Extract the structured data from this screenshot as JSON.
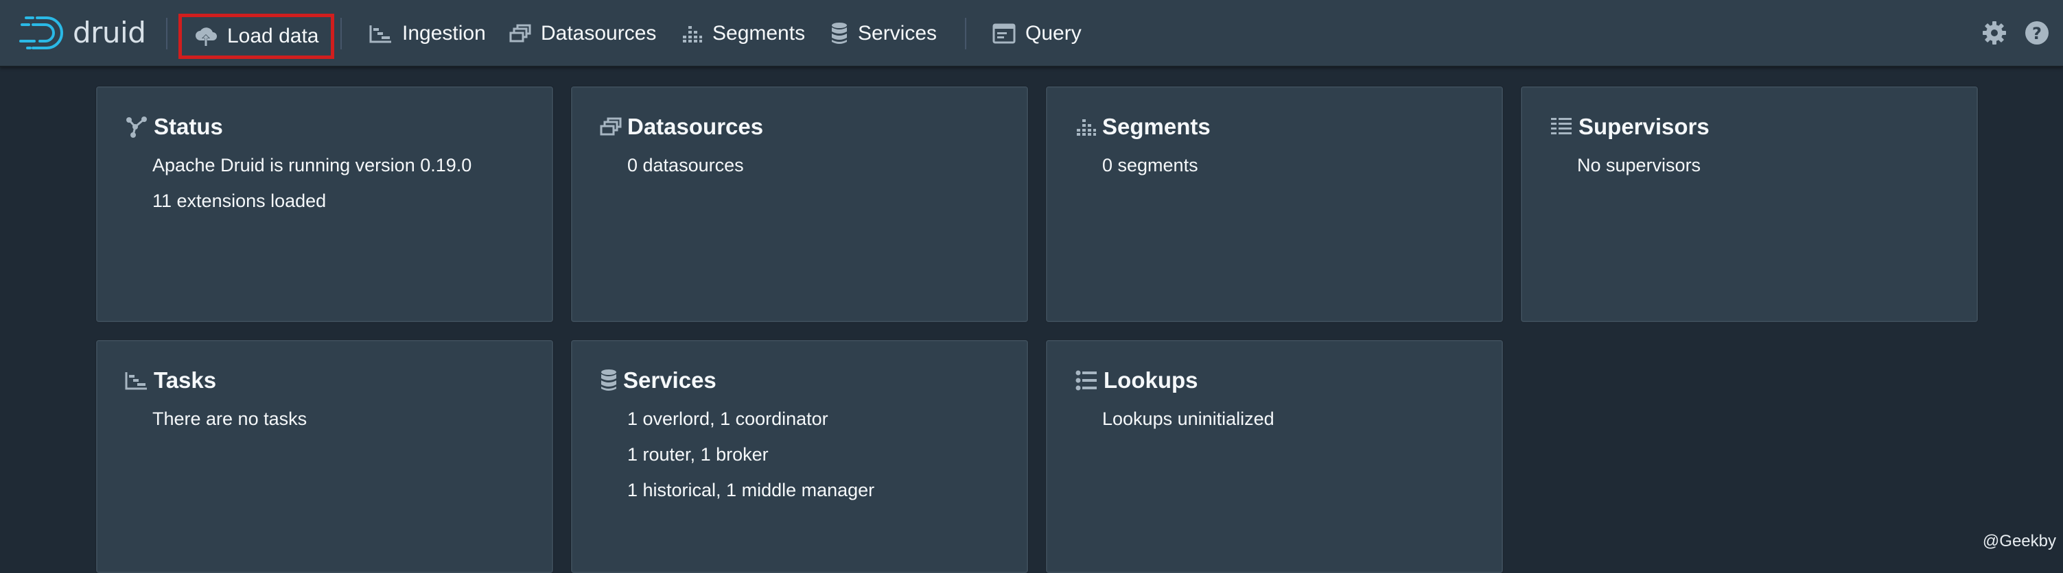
{
  "brand": {
    "name": "druid"
  },
  "nav": {
    "load_data": "Load data",
    "ingestion": "Ingestion",
    "datasources": "Datasources",
    "segments": "Segments",
    "services": "Services",
    "query": "Query"
  },
  "cards": {
    "status": {
      "title": "Status",
      "lines": [
        "Apache Druid is running version 0.19.0",
        "11 extensions loaded"
      ]
    },
    "datasources": {
      "title": "Datasources",
      "lines": [
        "0 datasources"
      ]
    },
    "segments": {
      "title": "Segments",
      "lines": [
        "0 segments"
      ]
    },
    "supervisors": {
      "title": "Supervisors",
      "lines": [
        "No supervisors"
      ]
    },
    "tasks": {
      "title": "Tasks",
      "lines": [
        "There are no tasks"
      ]
    },
    "services": {
      "title": "Services",
      "lines": [
        "1 overlord, 1 coordinator",
        "1 router, 1 broker",
        "1 historical, 1 middle manager"
      ]
    },
    "lookups": {
      "title": "Lookups",
      "lines": [
        "Lookups uninitialized"
      ]
    }
  },
  "icons": {
    "logo": "druid-logo",
    "load_data": "cloud-upload-icon",
    "ingestion": "gantt-chart-icon",
    "datasources": "multi-select-icon",
    "segments": "stacked-chart-icon",
    "services": "database-icon",
    "query": "application-icon",
    "settings": "cog-icon",
    "help": "help-icon",
    "status": "graph-icon",
    "supervisors": "list-columns-icon",
    "lookups": "properties-icon"
  },
  "colors": {
    "navbar": "#30404d",
    "background": "#1f2a35",
    "card": "#30404d",
    "highlight": "#d11e1e",
    "icon": "#a7b6c2",
    "logo": "#2ab9e6"
  },
  "watermark": "@Geekby"
}
